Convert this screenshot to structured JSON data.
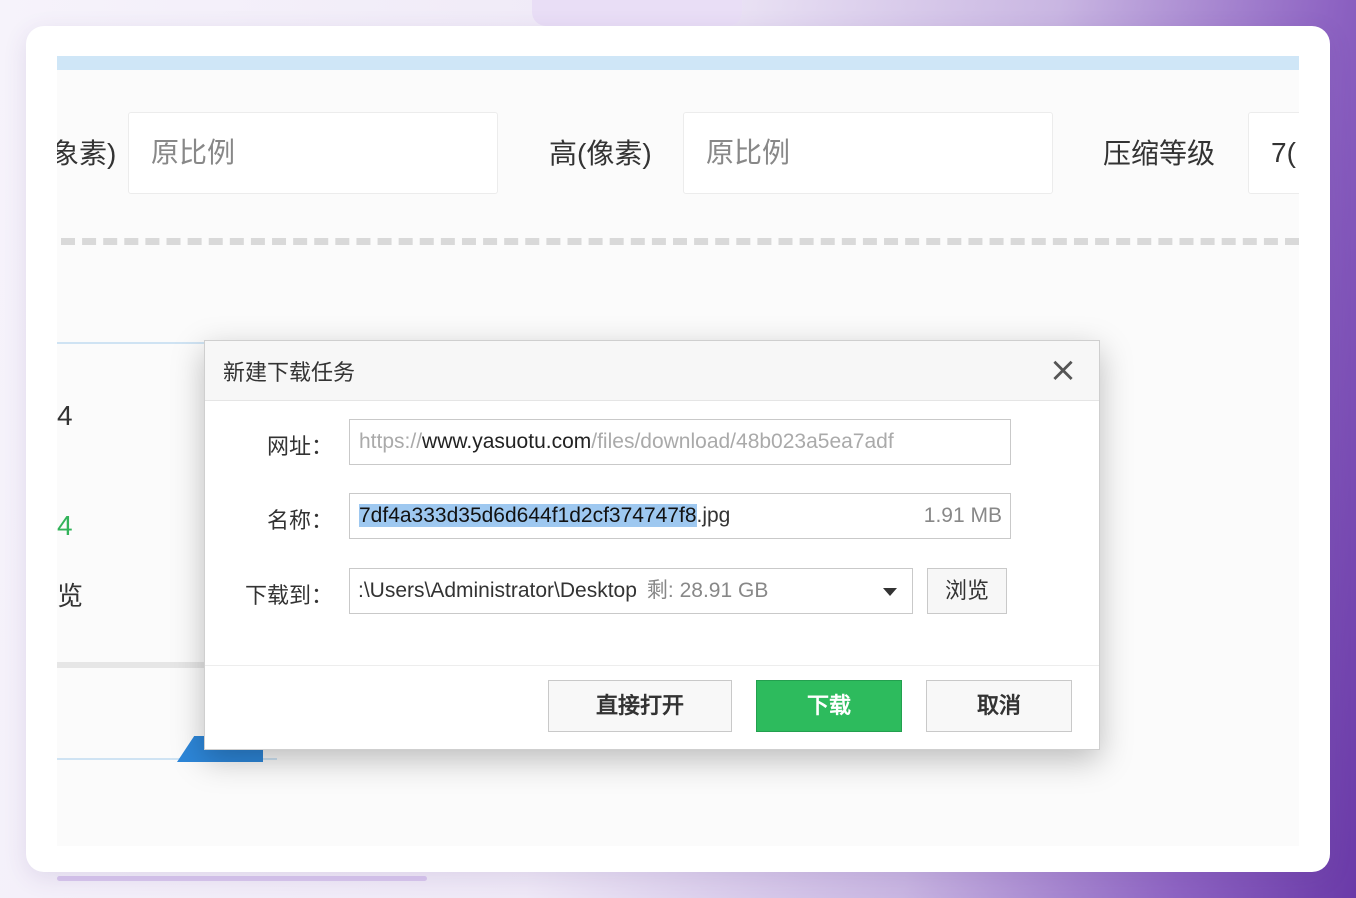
{
  "background": {
    "width_label": "象素)",
    "width_value": "原比例",
    "height_label": "高(像素)",
    "height_value": "原比例",
    "compress_label": "压缩等级",
    "compress_value": "7(",
    "left_num_1": "4",
    "left_num_2": "4",
    "left_text": "览"
  },
  "dialog": {
    "title": "新建下载任务",
    "close_symbol": "×",
    "url_label": "网址：",
    "url_prefix": "https://",
    "url_domain": "www.yasuotu.com",
    "url_rest": "/files/download/48b023a5ea7adf",
    "name_label": "名称：",
    "name_selected": "7df4a333d35d6d644f1d2cf374747f8",
    "name_ext": ".jpg",
    "file_size": "1.91 MB",
    "saveto_label": "下载到：",
    "path": ":\\Users\\Administrator\\Desktop",
    "free_label": "剩:",
    "free_space": "28.91 GB",
    "browse_label": "浏览",
    "open_label": "直接打开",
    "download_label": "下载",
    "cancel_label": "取消"
  },
  "colors": {
    "download_button": "#2dbb5d",
    "selection": "#9ec8f0",
    "accent_blue": "#2d86d8"
  }
}
